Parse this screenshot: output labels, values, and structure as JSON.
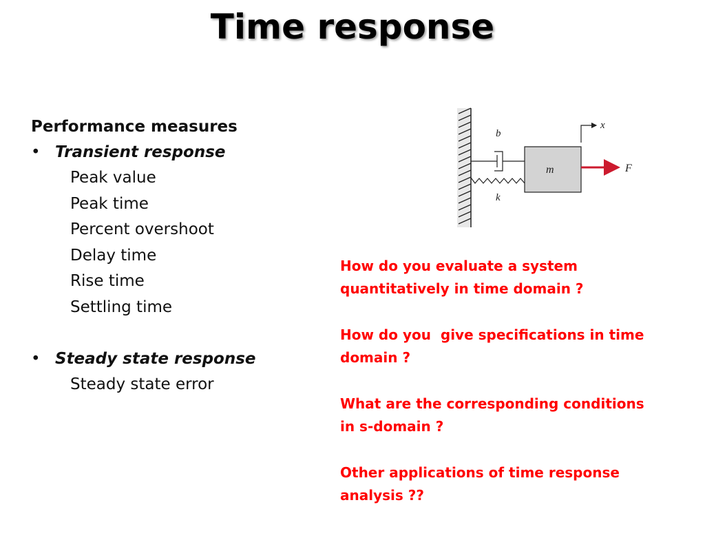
{
  "slide": {
    "title": "Time response"
  },
  "performance": {
    "heading": "Performance measures",
    "bullets": [
      {
        "label": "Transient response",
        "items": [
          "Peak value",
          "Peak time",
          "Percent overshoot",
          "Delay time",
          "Rise time",
          "Settling time"
        ]
      },
      {
        "label": "Steady state response",
        "items": [
          "Steady state error"
        ]
      }
    ],
    "bullet_glyph": "•"
  },
  "questions": [
    "How do you evaluate a system\nquantitatively in time domain ?",
    "How do you  give specifications in time\ndomain ?",
    "What are the corresponding conditions\nin s-domain ?",
    "Other applications of time response\nanalysis ??"
  ],
  "diagram": {
    "labels": {
      "damper": "b",
      "spring": "k",
      "mass": "m",
      "force": "F",
      "displacement": "x"
    },
    "colors": {
      "mass_fill": "#d3d3d3",
      "force_arrow": "#cc1a2e",
      "wall_hatch": "#222222"
    }
  },
  "colors": {
    "question_text": "#ff0000",
    "body_text": "#111111"
  }
}
